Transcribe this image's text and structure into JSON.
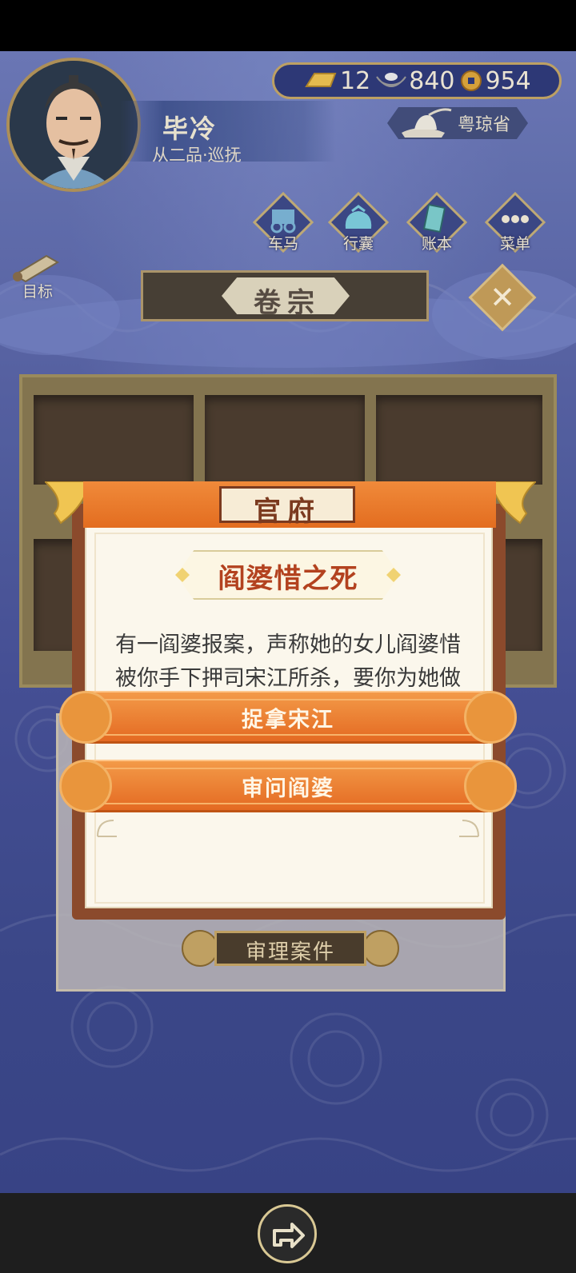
{
  "player": {
    "name": "毕冷",
    "title": "从二品·巡抚"
  },
  "currency": {
    "gold": "12",
    "silver": "840",
    "copper": "954"
  },
  "province": "粤琼省",
  "menu": {
    "items": [
      {
        "label": "车马",
        "icon": "carriage-icon"
      },
      {
        "label": "行囊",
        "icon": "bundle-icon"
      },
      {
        "label": "账本",
        "icon": "ledger-icon"
      },
      {
        "label": "菜单",
        "icon": "more-icon"
      }
    ]
  },
  "goal_label": "目标",
  "section_title": "卷宗",
  "review_button_label": "审理案件",
  "modal": {
    "header": "官府",
    "case_title": "阎婆惜之死",
    "description": "有一阎婆报案，声称她的女儿阎婆惜被你手下押司宋江所杀，要你为她做主...",
    "choices": [
      "捉拿宋江",
      "审问阎婆"
    ]
  },
  "colors": {
    "accent_orange": "#e46a22",
    "frame_brown": "#8b4a2c",
    "gold_trim": "#c7a867",
    "background_blue": "#48539a"
  }
}
